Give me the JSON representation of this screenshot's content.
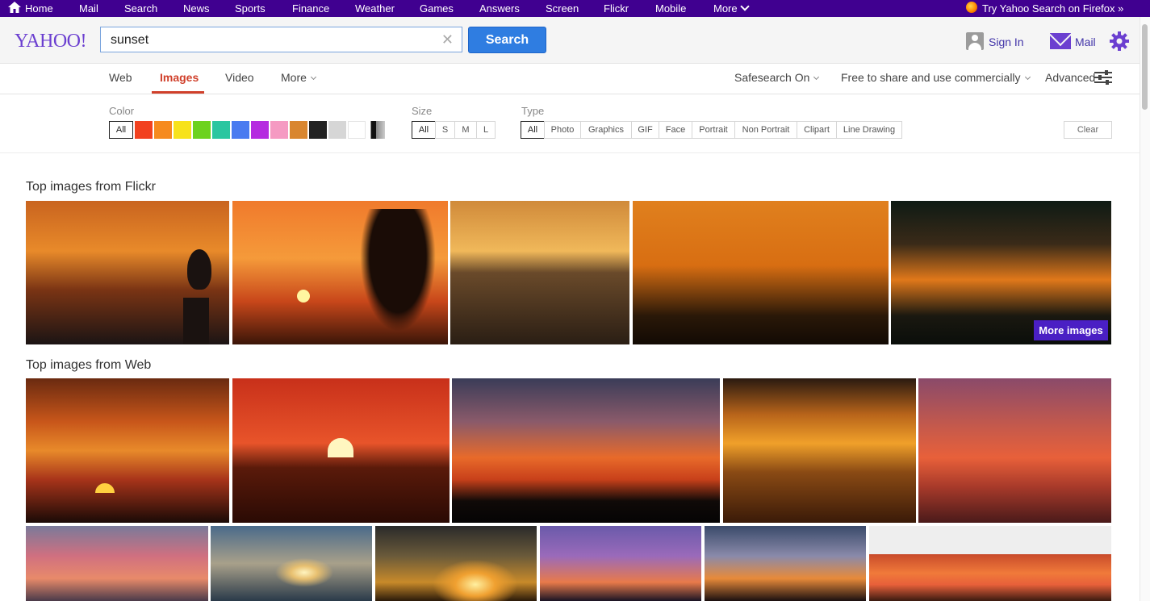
{
  "topbar": {
    "items": [
      "Home",
      "Mail",
      "Search",
      "News",
      "Sports",
      "Finance",
      "Weather",
      "Games",
      "Answers",
      "Screen",
      "Flickr",
      "Mobile",
      "More"
    ],
    "promo": "Try Yahoo Search on Firefox »"
  },
  "header": {
    "logo": "YAHOO!",
    "search_value": "sunset",
    "search_button": "Search",
    "sign_in": "Sign In",
    "mail": "Mail"
  },
  "tabs": {
    "items": [
      "Web",
      "Images",
      "Video",
      "More"
    ],
    "active": "Images",
    "safesearch": "Safesearch On",
    "license": "Free to share and use commercially",
    "advanced": "Advanced"
  },
  "filters": {
    "color_label": "Color",
    "color_all": "All",
    "colors": [
      "#f2411f",
      "#f68a1e",
      "#f7e21b",
      "#6dd21e",
      "#2bc6a0",
      "#4a7bf0",
      "#b52be0",
      "#f59ac2",
      "#d9862f",
      "#222222",
      "#d6d6d6",
      "#ffffff"
    ],
    "size_label": "Size",
    "sizes": [
      "All",
      "S",
      "M",
      "L"
    ],
    "type_label": "Type",
    "types": [
      "All",
      "Photo",
      "Graphics",
      "GIF",
      "Face",
      "Portrait",
      "Non Portrait",
      "Clipart",
      "Line Drawing"
    ],
    "clear": "Clear"
  },
  "sections": {
    "flickr_title": "Top images from Flickr",
    "web_title": "Top images from Web",
    "more_images": "More images"
  },
  "colors": {
    "topbar": "#400090",
    "accent": "#d0402b",
    "search_button": "#2f7de1",
    "brand": "#6b3fd0"
  }
}
